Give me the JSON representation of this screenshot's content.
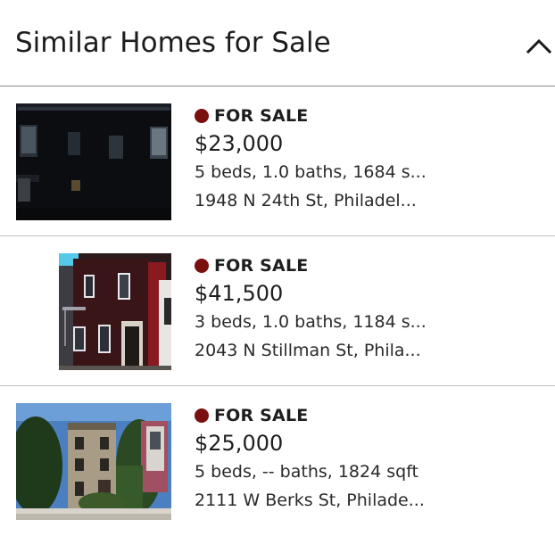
{
  "header": {
    "title": "Similar Homes for Sale",
    "collapse_icon": "chevron-up-icon"
  },
  "listings": [
    {
      "status": "FOR SALE",
      "status_color": "#7a0f0f",
      "price": "$23,000",
      "details": "5 beds, 1.0 baths, 1684 s...",
      "address": "1948 N 24th St, Philadel..."
    },
    {
      "status": "FOR SALE",
      "status_color": "#7a0f0f",
      "price": "$41,500",
      "details": "3 beds, 1.0 baths, 1184 s...",
      "address": "2043 N Stillman St, Phila..."
    },
    {
      "status": "FOR SALE",
      "status_color": "#7a0f0f",
      "price": "$25,000",
      "details": "5 beds, -- baths, 1824 sqft",
      "address": "2111 W Berks St, Philade..."
    }
  ]
}
